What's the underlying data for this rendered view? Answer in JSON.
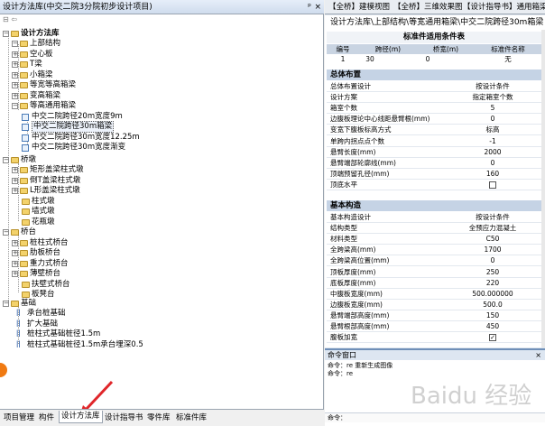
{
  "left_panel": {
    "title": "设计方法库(中交二院3分院初步设计项目)",
    "pin": "ᵖ",
    "close": "×",
    "toolbar": "⊟ ⇦"
  },
  "tree": [
    {
      "label": "设计方法库",
      "bold": true
    },
    {
      "label": "上部结构"
    },
    {
      "label": "空心板"
    },
    {
      "label": "T梁"
    },
    {
      "label": "小箱梁"
    },
    {
      "label": "等宽等高箱梁"
    },
    {
      "label": "变高箱梁"
    },
    {
      "label": "等高通用箱梁"
    },
    {
      "label": "中交二院跨径20m宽度9m"
    },
    {
      "label": "中交二院跨径30m箱梁"
    },
    {
      "label": "中交二院跨径30m宽度12.25m"
    },
    {
      "label": "中交二院跨径30m宽度渐变"
    },
    {
      "label": "桥墩"
    },
    {
      "label": "矩形盖梁柱式墩"
    },
    {
      "label": "倒T盖梁柱式墩"
    },
    {
      "label": "L形盖梁柱式墩"
    },
    {
      "label": "柱式墩"
    },
    {
      "label": "墙式墩"
    },
    {
      "label": "花瓶墩"
    },
    {
      "label": "桥台"
    },
    {
      "label": "桩柱式桥台"
    },
    {
      "label": "肋板桥台"
    },
    {
      "label": "重力式桥台"
    },
    {
      "label": "薄壁桥台"
    },
    {
      "label": "扶壁式桥台"
    },
    {
      "label": "板凳台"
    },
    {
      "label": "基础"
    },
    {
      "label": "承台桩基础"
    },
    {
      "label": "扩大基础"
    },
    {
      "label": "桩柱式基础桩径1.5m"
    },
    {
      "label": "桩柱式基础桩径1.5m承台埋深0.5"
    }
  ],
  "bottom_tabs": [
    "项目管理",
    "构件",
    "设计方法库",
    "设计指导书",
    "零件库",
    "标准件库"
  ],
  "top_tabs": [
    "【全桥】建模视图",
    "【全桥】三维效果图",
    "【设计指导书】通用箱梁"
  ],
  "doc_title": "设计方法库\\上部结构\\等宽通用箱梁\\中交二院跨径30m箱梁",
  "std_table": {
    "title": "标准件适用条件表",
    "headers": [
      "编号",
      "跨径(m)",
      "桥宽(m)",
      "标准件名称"
    ],
    "row": [
      "1",
      "30",
      "0",
      "无"
    ]
  },
  "sections": [
    {
      "title": "总体布置",
      "rows": [
        {
          "name": "总体布置设计",
          "value": "按设计条件"
        },
        {
          "name": "设计方案",
          "value": "指定箱室个数"
        },
        {
          "name": "箱室个数",
          "value": "5"
        },
        {
          "name": "边腹板理论中心线距悬臂根(mm)",
          "value": "0"
        },
        {
          "name": "变宽下腹板标高方式",
          "value": "标高"
        },
        {
          "name": "单跨内拐点点个数",
          "value": "-1"
        },
        {
          "name": "悬臂长度(mm)",
          "value": "2000"
        },
        {
          "name": "悬臂端部轮廓线(mm)",
          "value": "0"
        },
        {
          "name": "顶端预留孔径(mm)",
          "value": "160"
        },
        {
          "name": "顶底水平",
          "value": "",
          "checkbox": true,
          "checked": false
        }
      ]
    },
    {
      "title": "基本构造",
      "rows": [
        {
          "name": "基本构造设计",
          "value": "按设计条件"
        },
        {
          "name": "结构类型",
          "value": "全预应力混凝土"
        },
        {
          "name": "材料类型",
          "value": "C50"
        },
        {
          "name": "全跨梁高(mm)",
          "value": "1700"
        },
        {
          "name": "全跨梁高位置(mm)",
          "value": "0"
        },
        {
          "name": "顶板厚度(mm)",
          "value": "250"
        },
        {
          "name": "底板厚度(mm)",
          "value": "220"
        },
        {
          "name": "中腹板宽度(mm)",
          "value": "500.000000"
        },
        {
          "name": "边腹板宽度(mm)",
          "value": "500.0"
        },
        {
          "name": "悬臂端部高度(mm)",
          "value": "150"
        },
        {
          "name": "悬臂根部高度(mm)",
          "value": "450"
        },
        {
          "name": "腹板加宽",
          "value": "",
          "checkbox": true,
          "checked": true
        }
      ]
    }
  ],
  "command_window": {
    "title": "命令窗口",
    "close": "×",
    "lines": [
      "命令：re  重新生成图像",
      "命令：re"
    ],
    "input": "命令："
  },
  "watermark": "Baidu 经验"
}
